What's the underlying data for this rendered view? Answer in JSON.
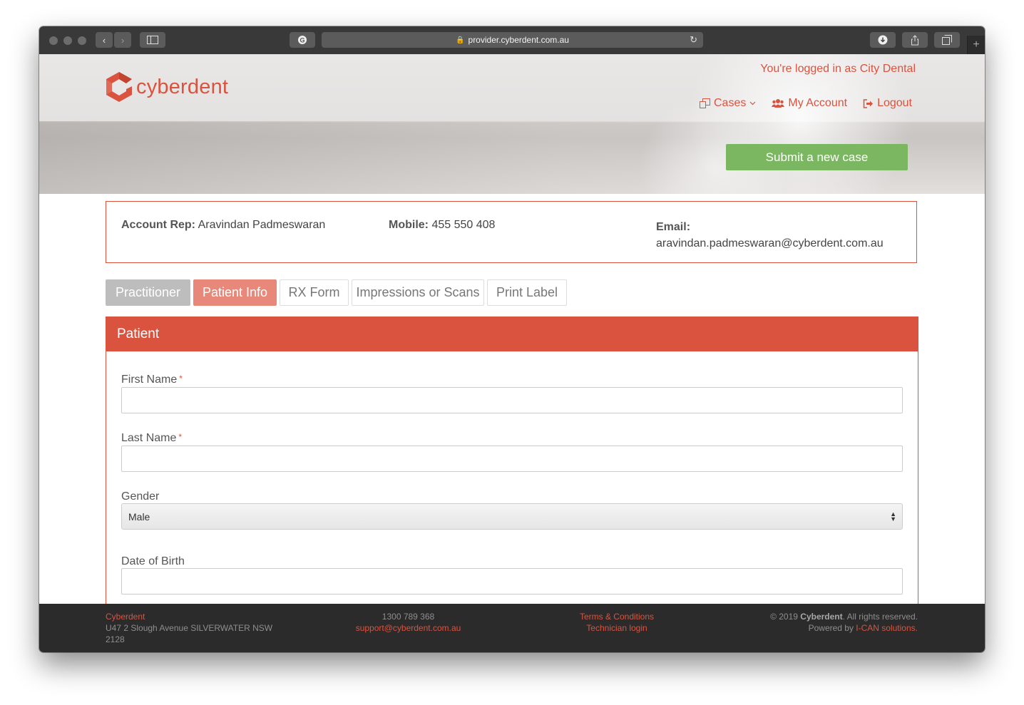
{
  "browser": {
    "url": "provider.cyberdent.com.au"
  },
  "header": {
    "logo_text": "cyberdent",
    "logged_in_text": "You're logged in as City Dental",
    "nav": {
      "cases": "Cases",
      "my_account": "My Account",
      "logout": "Logout"
    },
    "submit_button": "Submit a new case"
  },
  "account_rep": {
    "rep_label": "Account Rep:",
    "rep_name": "Aravindan Padmeswaran",
    "mobile_label": "Mobile:",
    "mobile_value": "455 550 408",
    "email_label": "Email:",
    "email_value": "aravindan.padmeswaran@cyberdent.com.au"
  },
  "tabs": [
    {
      "label": "Practitioner"
    },
    {
      "label": "Patient Info"
    },
    {
      "label": "RX Form"
    },
    {
      "label": "Impressions or Scans"
    },
    {
      "label": "Print Label"
    }
  ],
  "patient_form": {
    "title": "Patient",
    "first_name_label": "First Name",
    "last_name_label": "Last Name",
    "required_mark": "*",
    "gender_label": "Gender",
    "gender_value": "Male",
    "dob_label": "Date of Birth",
    "first_name_value": "",
    "last_name_value": "",
    "dob_value": ""
  },
  "footer": {
    "company": "Cyberdent",
    "address": "U47 2 Slough Avenue SILVERWATER NSW 2128",
    "phone": "1300 789 368",
    "email": "support@cyberdent.com.au",
    "terms": "Terms & Conditions",
    "technician_login": "Technician login",
    "copyright_prefix": "© 2019 ",
    "copyright_company": "Cyberdent",
    "copyright_suffix": ". All rights reserved.",
    "powered_prefix": "Powered by ",
    "powered_link": "I-CAN solutions."
  },
  "colors": {
    "accent": "#d9533f",
    "submit_green": "#7bb661",
    "footer_bg": "#2b2b2b"
  }
}
